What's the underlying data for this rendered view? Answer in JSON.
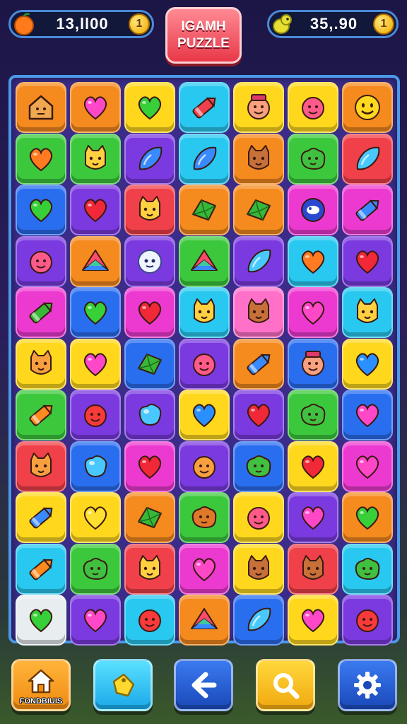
{
  "hud": {
    "left_value": "13,ll00",
    "left_coin": "1",
    "right_value": "35,.90",
    "right_coin": "1",
    "title_line1": "IGAMH",
    "title_line2": "PUZZLE"
  },
  "colors": {
    "red": "#f0404a",
    "orange": "#f58a1e",
    "yellow": "#ffd81e",
    "green": "#3cc83c",
    "blue": "#2a6ef0",
    "cyan": "#28c8f0",
    "purple": "#7a3ae0",
    "magenta": "#ec3ad0",
    "pink": "#ff70c8",
    "white": "#e8eef0"
  },
  "board": {
    "rows": [
      [
        {
          "c": "orange",
          "i": "house"
        },
        {
          "c": "orange",
          "i": "heart-magenta"
        },
        {
          "c": "yellow",
          "i": "heart-green"
        },
        {
          "c": "cyan",
          "i": "crayon-red"
        },
        {
          "c": "yellow",
          "i": "face-hat"
        },
        {
          "c": "yellow",
          "i": "face-pink"
        },
        {
          "c": "orange",
          "i": "smiley-yellow"
        }
      ],
      [
        {
          "c": "green",
          "i": "heart-orange"
        },
        {
          "c": "green",
          "i": "cat-yellow"
        },
        {
          "c": "purple",
          "i": "drop-blue"
        },
        {
          "c": "cyan",
          "i": "drop-blue"
        },
        {
          "c": "orange",
          "i": "cat-brown"
        },
        {
          "c": "green",
          "i": "blob-green"
        },
        {
          "c": "red",
          "i": "drop-cyan"
        }
      ],
      [
        {
          "c": "blue",
          "i": "heart-green"
        },
        {
          "c": "purple",
          "i": "heart-red"
        },
        {
          "c": "red",
          "i": "cat-yellow"
        },
        {
          "c": "orange",
          "i": "gem-green"
        },
        {
          "c": "orange",
          "i": "gem-green"
        },
        {
          "c": "magenta",
          "i": "bubble-blue"
        },
        {
          "c": "magenta",
          "i": "crayon-blue"
        }
      ],
      [
        {
          "c": "purple",
          "i": "face-pink"
        },
        {
          "c": "orange",
          "i": "prism"
        },
        {
          "c": "purple",
          "i": "face-ghost"
        },
        {
          "c": "green",
          "i": "prism"
        },
        {
          "c": "purple",
          "i": "drop-cyan"
        },
        {
          "c": "cyan",
          "i": "heart-orange"
        },
        {
          "c": "purple",
          "i": "heart-red"
        }
      ],
      [
        {
          "c": "magenta",
          "i": "crayon-green"
        },
        {
          "c": "blue",
          "i": "heart-green"
        },
        {
          "c": "magenta",
          "i": "heart-red"
        },
        {
          "c": "cyan",
          "i": "cat-yellow"
        },
        {
          "c": "pink",
          "i": "cat-brown"
        },
        {
          "c": "magenta",
          "i": "heart-magenta"
        },
        {
          "c": "cyan",
          "i": "cat-yellow"
        }
      ],
      [
        {
          "c": "yellow",
          "i": "cat-orange"
        },
        {
          "c": "yellow",
          "i": "heart-magenta"
        },
        {
          "c": "blue",
          "i": "gem-green"
        },
        {
          "c": "purple",
          "i": "face-pink"
        },
        {
          "c": "orange",
          "i": "crayon-blue"
        },
        {
          "c": "blue",
          "i": "face-hat"
        },
        {
          "c": "yellow",
          "i": "heart-blue"
        }
      ],
      [
        {
          "c": "green",
          "i": "crayon-orange"
        },
        {
          "c": "purple",
          "i": "face-red"
        },
        {
          "c": "purple",
          "i": "bubble-cyan"
        },
        {
          "c": "yellow",
          "i": "heart-blue"
        },
        {
          "c": "purple",
          "i": "heart-red"
        },
        {
          "c": "green",
          "i": "blob-green"
        },
        {
          "c": "blue",
          "i": "heart-magenta"
        }
      ],
      [
        {
          "c": "red",
          "i": "cat-orange"
        },
        {
          "c": "blue",
          "i": "bubble-cyan"
        },
        {
          "c": "magenta",
          "i": "heart-red"
        },
        {
          "c": "purple",
          "i": "face-orange"
        },
        {
          "c": "blue",
          "i": "blob-green"
        },
        {
          "c": "yellow",
          "i": "heart-red"
        },
        {
          "c": "magenta",
          "i": "heart-magenta"
        }
      ],
      [
        {
          "c": "yellow",
          "i": "crayon-blue"
        },
        {
          "c": "yellow",
          "i": "heart-yellow"
        },
        {
          "c": "orange",
          "i": "gem-green"
        },
        {
          "c": "green",
          "i": "blob-orange"
        },
        {
          "c": "yellow",
          "i": "face-pink"
        },
        {
          "c": "purple",
          "i": "heart-magenta"
        },
        {
          "c": "orange",
          "i": "heart-green"
        }
      ],
      [
        {
          "c": "cyan",
          "i": "crayon-orange"
        },
        {
          "c": "green",
          "i": "blob-green"
        },
        {
          "c": "red",
          "i": "cat-yellow"
        },
        {
          "c": "magenta",
          "i": "heart-magenta"
        },
        {
          "c": "yellow",
          "i": "cat-brown"
        },
        {
          "c": "red",
          "i": "cat-brown"
        },
        {
          "c": "cyan",
          "i": "blob-green"
        }
      ],
      [
        {
          "c": "white",
          "i": "heart-green"
        },
        {
          "c": "purple",
          "i": "heart-magenta"
        },
        {
          "c": "cyan",
          "i": "face-red"
        },
        {
          "c": "orange",
          "i": "prism"
        },
        {
          "c": "blue",
          "i": "drop-cyan"
        },
        {
          "c": "yellow",
          "i": "heart-magenta"
        },
        {
          "c": "purple",
          "i": "face-red"
        }
      ]
    ]
  },
  "toolbar": {
    "home_label": "FONDBIUIS",
    "home_icon": "house-icon",
    "hint_icon": "tag-icon",
    "back_icon": "arrow-left-icon",
    "search_icon": "search-icon",
    "settings_icon": "gear-icon"
  }
}
